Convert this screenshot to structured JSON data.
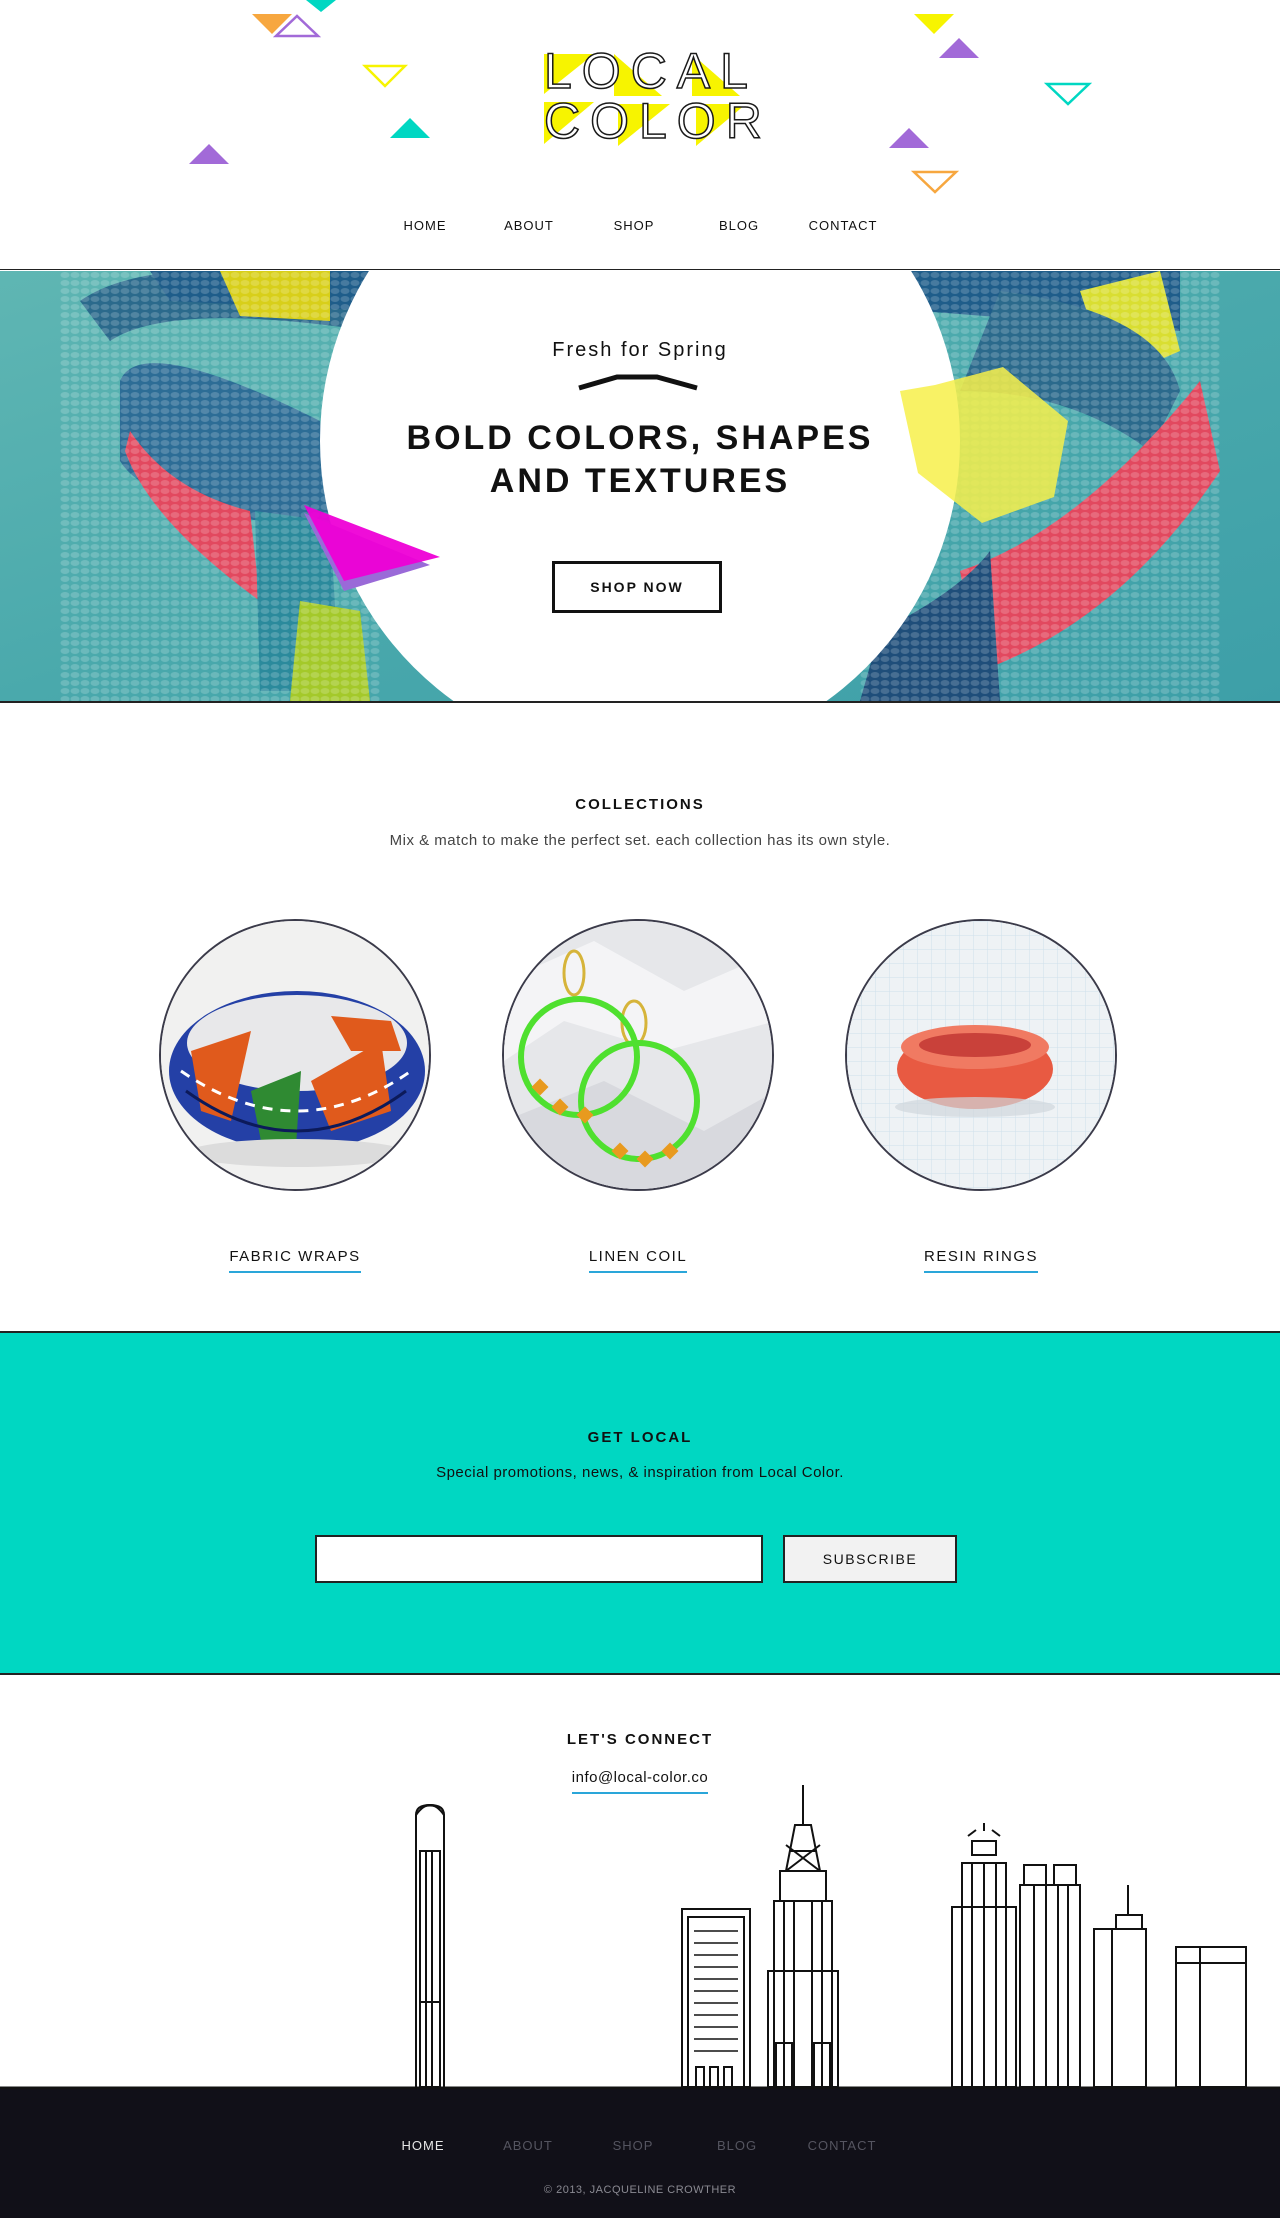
{
  "brand": {
    "logo_line_1": "LOCAL",
    "logo_line_2": "COLOR",
    "colors": {
      "yellow": "#f7f400",
      "teal": "#00d7c2",
      "purple": "#a26ad8",
      "orange": "#f7a73f",
      "magenta": "#ee00d6",
      "underline_blue": "#2aa6d9",
      "footer_bg": "#111018"
    }
  },
  "nav": {
    "items": [
      {
        "label": "HOME"
      },
      {
        "label": "ABOUT"
      },
      {
        "label": "SHOP"
      },
      {
        "label": "BLOG"
      },
      {
        "label": "CONTACT"
      }
    ]
  },
  "hero": {
    "kicker": "Fresh for Spring",
    "title_line_1": "BOLD COLORS, SHAPES",
    "title_line_2": "AND TEXTURES",
    "cta_label": "SHOP NOW"
  },
  "collections": {
    "heading": "COLLECTIONS",
    "subtitle": "Mix & match to make the perfect set. each collection has its own style.",
    "items": [
      {
        "label": "FABRIC WRAPS"
      },
      {
        "label": "LINEN COIL"
      },
      {
        "label": "RESIN RINGS"
      }
    ]
  },
  "newsletter": {
    "heading": "GET LOCAL",
    "subtitle": "Special promotions, news, & inspiration from Local Color.",
    "email_value": "",
    "subscribe_label": "SUBSCRIBE"
  },
  "connect": {
    "heading": "LET'S CONNECT",
    "email": "info@local-color.co"
  },
  "footer": {
    "nav": [
      {
        "label": "HOME"
      },
      {
        "label": "ABOUT"
      },
      {
        "label": "SHOP"
      },
      {
        "label": "BLOG"
      },
      {
        "label": "CONTACT"
      }
    ],
    "copyright": "© 2013, JACQUELINE CROWTHER"
  }
}
